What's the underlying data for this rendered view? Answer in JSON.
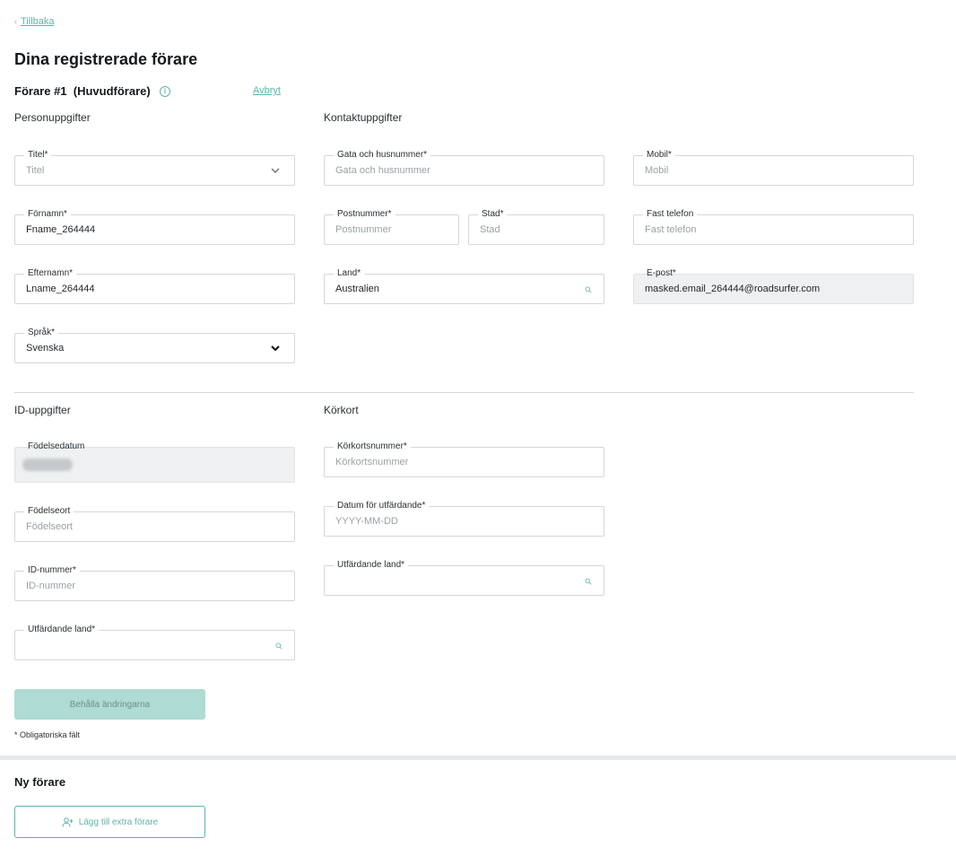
{
  "nav": {
    "back_chevron": "‹",
    "back_label": "Tillbaka"
  },
  "page_title": "Dina registrerade förare",
  "driver": {
    "title": "Förare #1  (Huvudförare)",
    "info_icon_glyph": "i",
    "cancel_label": "Avbryt"
  },
  "sections": {
    "personal": "Personuppgifter",
    "contact": "Kontaktuppgifter",
    "id": "ID-uppgifter",
    "license": "Körkort"
  },
  "fields": {
    "title": {
      "label": "Titel*",
      "placeholder": "Titel"
    },
    "first_name": {
      "label": "Förnamn*",
      "value": "Fname_264444"
    },
    "last_name": {
      "label": "Efternamn*",
      "value": "Lname_264444"
    },
    "language": {
      "label": "Språk*",
      "value": "Svenska"
    },
    "street": {
      "label": "Gata och husnummer*",
      "placeholder": "Gata och husnummer"
    },
    "postal_code": {
      "label": "Postnummer*",
      "placeholder": "Postnummer"
    },
    "city": {
      "label": "Stad*",
      "placeholder": "Stad"
    },
    "country": {
      "label": "Land*",
      "value": "Australien"
    },
    "mobile": {
      "label": "Mobil*",
      "placeholder": "Mobil"
    },
    "landline": {
      "label": "Fast telefon",
      "placeholder": "Fast telefon"
    },
    "email": {
      "label": "E-post*",
      "value": "masked.email_264444@roadsurfer.com"
    },
    "birth_date": {
      "label": "Födelsedatum"
    },
    "birth_place": {
      "label": "Födelseort",
      "placeholder": "Födelseort"
    },
    "id_number": {
      "label": "ID-nummer*",
      "placeholder": "ID-nummer"
    },
    "id_issuing_country": {
      "label": "Utfärdande land*"
    },
    "license_number": {
      "label": "Körkortsnummer*",
      "placeholder": "Körkortsnummer"
    },
    "issue_date": {
      "label": "Datum för utfärdande*",
      "placeholder": "YYYY-MM-DD"
    },
    "license_issuing_country": {
      "label": "Utfärdande land*"
    }
  },
  "actions": {
    "save_label": "Behålla ändringarna",
    "required_note": "* Obligatoriska fält"
  },
  "new_driver": {
    "title": "Ny förare",
    "add_label": "Lägg till extra förare"
  },
  "colors": {
    "accent": "#5fb3a8",
    "button_disabled": "#aedbd4",
    "border": "#d3d7da",
    "disabled_field": "#eef0f2"
  }
}
